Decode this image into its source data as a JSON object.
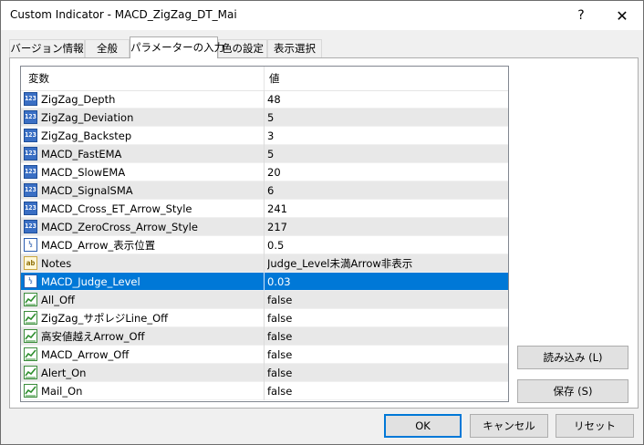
{
  "window": {
    "title": "Custom Indicator - MACD_ZigZag_DT_Mai",
    "help_label": "?",
    "close_label": "✕"
  },
  "tabs": [
    {
      "label": "バージョン情報"
    },
    {
      "label": "全般"
    },
    {
      "label": "パラメーターの入力"
    },
    {
      "label": "色の設定"
    },
    {
      "label": "表示選択"
    }
  ],
  "active_tab": 2,
  "table": {
    "header_variable": "変数",
    "header_value": "値",
    "rows": [
      {
        "icon": "int",
        "icon_text": "123",
        "name": "ZigZag_Depth",
        "value": "48"
      },
      {
        "icon": "int",
        "icon_text": "123",
        "name": "ZigZag_Deviation",
        "value": "5"
      },
      {
        "icon": "int",
        "icon_text": "123",
        "name": "ZigZag_Backstep",
        "value": "3"
      },
      {
        "icon": "int",
        "icon_text": "123",
        "name": "MACD_FastEMA",
        "value": "5"
      },
      {
        "icon": "int",
        "icon_text": "123",
        "name": "MACD_SlowEMA",
        "value": "20"
      },
      {
        "icon": "int",
        "icon_text": "123",
        "name": "MACD_SignalSMA",
        "value": "6"
      },
      {
        "icon": "int",
        "icon_text": "123",
        "name": "MACD_Cross_ET_Arrow_Style",
        "value": "241"
      },
      {
        "icon": "int",
        "icon_text": "123",
        "name": "MACD_ZeroCross_Arrow_Style",
        "value": "217"
      },
      {
        "icon": "dbl",
        "icon_text": "½",
        "name": "MACD_Arrow_表示位置",
        "value": "0.5"
      },
      {
        "icon": "str",
        "icon_text": "ab",
        "name": "Notes",
        "value": "Judge_Level未満Arrow非表示"
      },
      {
        "icon": "dbl",
        "icon_text": "½",
        "name": "MACD_Judge_Level",
        "value": "0.03"
      },
      {
        "icon": "bool",
        "icon_text": "",
        "name": "All_Off",
        "value": "false"
      },
      {
        "icon": "bool",
        "icon_text": "",
        "name": "ZigZag_サポレジLine_Off",
        "value": "false"
      },
      {
        "icon": "bool",
        "icon_text": "",
        "name": "高安値越えArrow_Off",
        "value": "false"
      },
      {
        "icon": "bool",
        "icon_text": "",
        "name": "MACD_Arrow_Off",
        "value": "false"
      },
      {
        "icon": "bool",
        "icon_text": "",
        "name": "Alert_On",
        "value": "false"
      },
      {
        "icon": "bool",
        "icon_text": "",
        "name": "Mail_On",
        "value": "false"
      }
    ],
    "selected_row": 10
  },
  "side_buttons": {
    "load": "読み込み (L)",
    "save": "保存 (S)"
  },
  "footer_buttons": {
    "ok": "OK",
    "cancel": "キャンセル",
    "reset": "リセット"
  },
  "colors": {
    "selection": "#0078d7",
    "alt_row": "#e8e8e8",
    "dialog_bg": "#f0f0f0"
  }
}
